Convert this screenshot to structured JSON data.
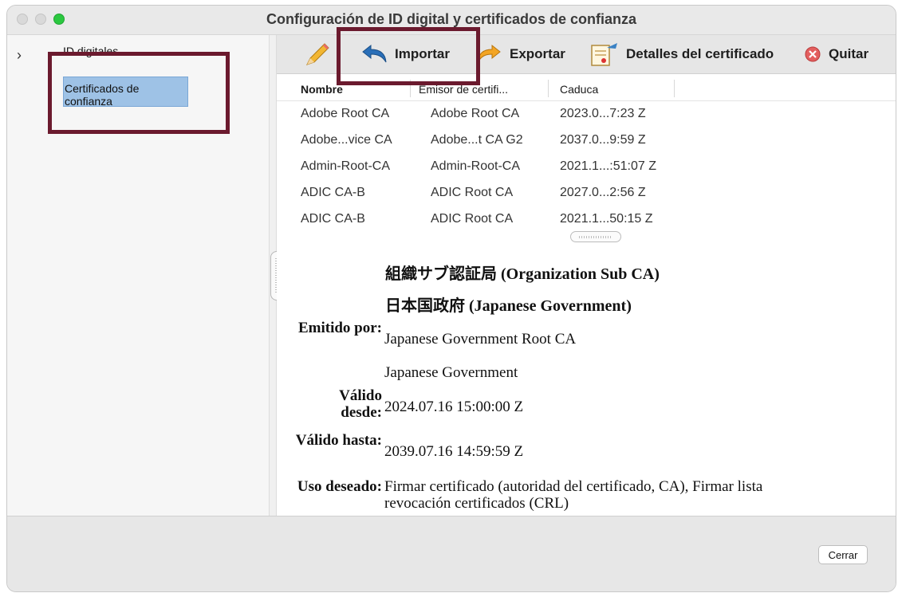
{
  "window": {
    "title": "Configuración de ID digital y certificados de confianza"
  },
  "sidebar": {
    "items": [
      {
        "label": "ID digitales"
      },
      {
        "label": "Certificados de confianza"
      }
    ]
  },
  "toolbar": {
    "import_label": "Importar",
    "export_label": "Exportar",
    "details_label": "Detalles del certificado",
    "remove_label": "Quitar"
  },
  "table": {
    "columns": [
      "Nombre",
      "Emisor de certifi...",
      "Caduca"
    ],
    "rows": [
      [
        "Adobe Root CA",
        "Adobe Root CA",
        "2023.0...7:23 Z"
      ],
      [
        "Adobe...vice CA",
        "Adobe...t CA G2",
        "2037.0...9:59 Z"
      ],
      [
        "Admin-Root-CA",
        "Admin-Root-CA",
        "2021.1...:51:07 Z"
      ],
      [
        "ADIC CA-B",
        "ADIC Root CA",
        "2027.0...2:56 Z"
      ],
      [
        "ADIC CA-B",
        "ADIC Root CA",
        "2021.1...50:15 Z"
      ]
    ]
  },
  "details": {
    "subject": "組織サブ認証局 (Organization Sub CA)",
    "organization": "日本国政府 (Japanese Government)",
    "issued_by_label": "Emitido por:",
    "issued_by": "Japanese Government Root CA",
    "issued_by_org": "Japanese Government",
    "valid_from_label": "Válido desde:",
    "valid_from": "2024.07.16 15:00:00 Z",
    "valid_to_label": "Válido hasta:",
    "valid_to": "2039.07.16 14:59:59 Z",
    "usage_label": "Uso deseado:",
    "usage_line1": "Firmar certificado (autoridad del certificado, CA), Firmar lista",
    "usage_line2": "revocación certificados (CRL)"
  },
  "footer": {
    "close_label": "Cerrar"
  },
  "colors": {
    "highlight": "#9ec2e6",
    "annotation_box": "#6b1a2e",
    "traffic_green": "#2bc840"
  }
}
